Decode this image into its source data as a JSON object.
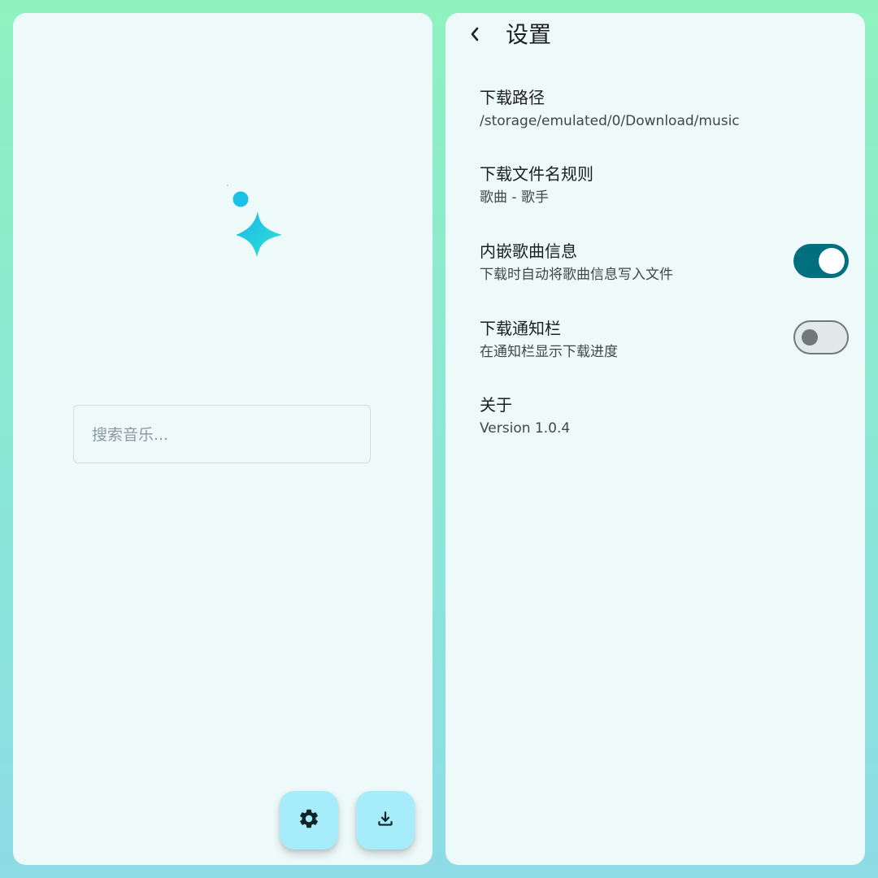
{
  "search": {
    "placeholder": "搜索音乐..."
  },
  "actions": {
    "settings_icon": "gear-icon",
    "download_icon": "download-icon"
  },
  "settings": {
    "title": "设置",
    "items": [
      {
        "title": "下载路径",
        "subtitle": "/storage/emulated/0/Download/music"
      },
      {
        "title": "下载文件名规则",
        "subtitle": "歌曲 - 歌手"
      },
      {
        "title": "内嵌歌曲信息",
        "subtitle": "下载时自动将歌曲信息写入文件",
        "toggle": true
      },
      {
        "title": "下载通知栏",
        "subtitle": "在通知栏显示下载进度",
        "toggle": false
      },
      {
        "title": "关于",
        "subtitle": "Version 1.0.4"
      }
    ]
  },
  "colors": {
    "accent": "#00707e",
    "fab_background": "#a6ecfa",
    "logo_cyan": "#1fc4e6"
  }
}
